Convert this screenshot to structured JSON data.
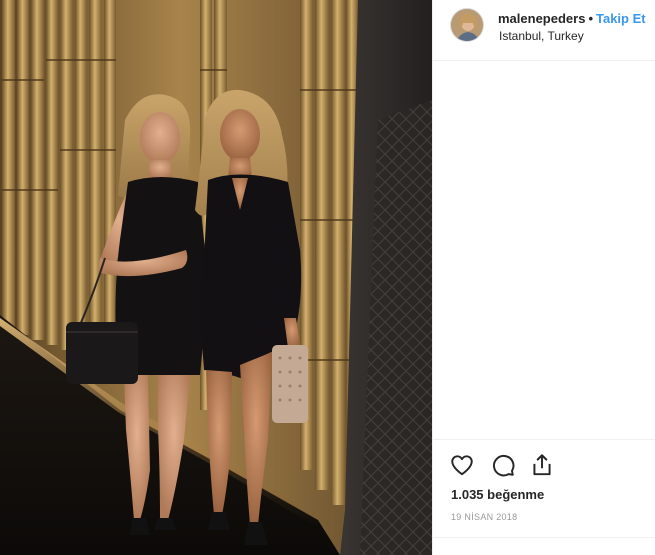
{
  "post": {
    "username": "malenepeders",
    "separator": "•",
    "follow_label": "Takip Et",
    "location": "Istanbul, Turkey",
    "likes_text": "1.035 beğenme",
    "date_text": "19 NİSAN 2018"
  },
  "icons": {
    "like": "heart-outline-icon",
    "comment": "speech-bubble-icon",
    "share": "share-upload-icon"
  },
  "colors": {
    "follow_link": "#3897f0",
    "text": "#262626",
    "muted": "#999999",
    "border": "#efefef"
  }
}
